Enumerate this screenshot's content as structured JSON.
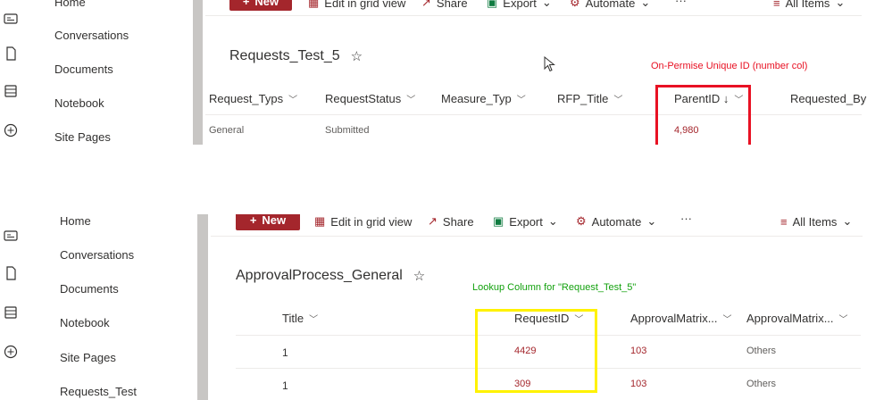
{
  "colors": {
    "accent": "#a4262c",
    "annotation_red": "#e81123",
    "annotation_green": "#13a10e",
    "highlight_yellow": "#fff200"
  },
  "panel1": {
    "nav": [
      "Home",
      "Conversations",
      "Documents",
      "Notebook",
      "Site Pages"
    ],
    "commands": {
      "new": "New",
      "grid": "Edit in grid view",
      "share": "Share",
      "export": "Export",
      "automate": "Automate",
      "more": "···",
      "view": "All Items"
    },
    "list_title": "Requests_Test_5",
    "annotation": "On-Permise Unique ID (number col)",
    "columns": [
      "Request_Typs",
      "RequestStatus",
      "Measure_Typ",
      "RFP_Title",
      "ParentID ↓",
      "Requested_By"
    ],
    "row": {
      "Request_Typs": "General",
      "RequestStatus": "Submitted",
      "ParentID": "4,980"
    }
  },
  "panel2": {
    "nav": [
      "Home",
      "Conversations",
      "Documents",
      "Notebook",
      "Site Pages",
      "Requests_Test"
    ],
    "commands": {
      "new": "New",
      "grid": "Edit in grid view",
      "share": "Share",
      "export": "Export",
      "automate": "Automate",
      "more": "···",
      "view": "All Items"
    },
    "list_title": "ApprovalProcess_General",
    "annotation": "Lookup Column for \"Request_Test_5\"",
    "columns": [
      "Title",
      "RequestID",
      "ApprovalMatrix...",
      "ApprovalMatrix..."
    ],
    "rows": [
      {
        "title": "1",
        "request_id": "4429",
        "am1": "103",
        "am2": "Others"
      },
      {
        "title": "1",
        "request_id": "309",
        "am1": "103",
        "am2": "Others"
      }
    ]
  }
}
